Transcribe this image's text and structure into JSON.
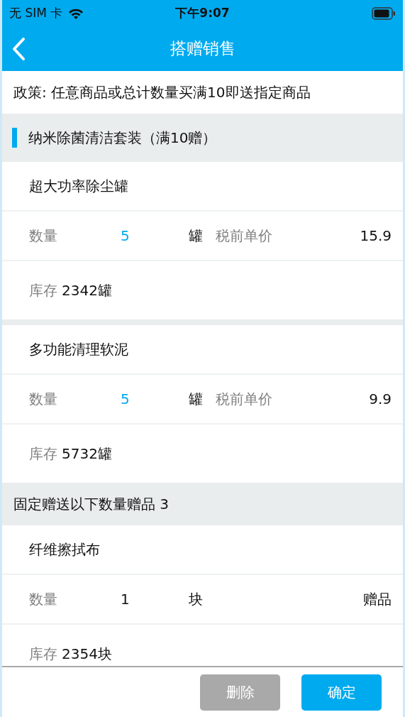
{
  "status_bar": {
    "carrier": "无 SIM 卡",
    "time": "下午9:07"
  },
  "nav": {
    "title": "搭赠销售"
  },
  "policy": "政策: 任意商品或总计数量买满10即送指定商品",
  "groups": [
    {
      "kind": "bundle",
      "title": "纳米除菌清洁套装（满10赠）",
      "items": [
        {
          "kind": "product",
          "name": "超大功率除尘罐",
          "qty_label": "数量",
          "qty": "5",
          "editable": true,
          "unit": "罐",
          "price_label": "税前单价",
          "price": "15.9",
          "stock_label": "库存",
          "stock": "2342罐"
        },
        {
          "kind": "product",
          "name": "多功能清理软泥",
          "qty_label": "数量",
          "qty": "5",
          "editable": true,
          "unit": "罐",
          "price_label": "税前单价",
          "price": "9.9",
          "stock_label": "库存",
          "stock": "5732罐"
        }
      ]
    },
    {
      "kind": "gift",
      "title": "固定赠送以下数量赠品 3",
      "items": [
        {
          "kind": "gift",
          "name": "纤维擦拭布",
          "qty_label": "数量",
          "qty": "1",
          "editable": false,
          "unit": "块",
          "tag": "赠品",
          "stock_label": "库存",
          "stock": "2354块"
        }
      ]
    }
  ],
  "buttons": [
    {
      "label": "删除",
      "disabled": true
    },
    {
      "label": "确定",
      "disabled": false
    }
  ]
}
